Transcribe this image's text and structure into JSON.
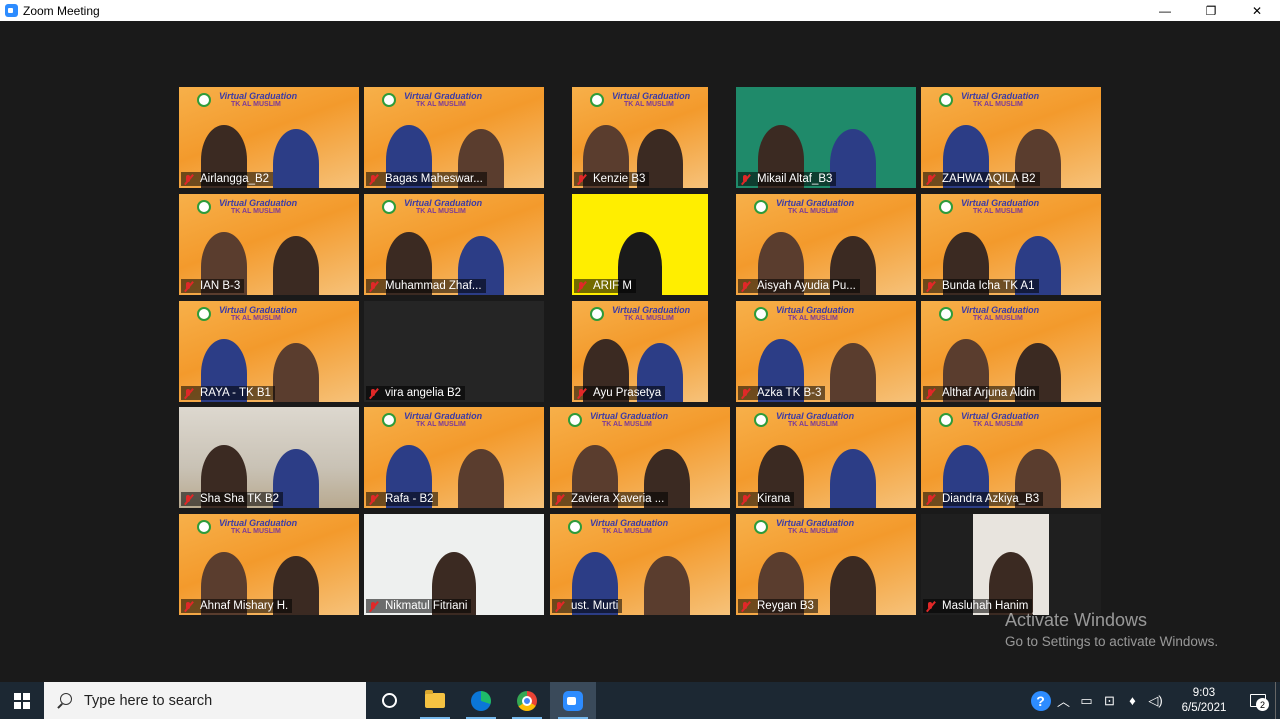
{
  "window": {
    "title": "Zoom Meeting",
    "minimize": "—",
    "restore": "❐",
    "close": "✕"
  },
  "banner": {
    "line1": "Virtual Graduation",
    "line2": "TK AL MUSLIM"
  },
  "participants": [
    {
      "name": "Airlangga_B2",
      "style": "orange",
      "muted": true
    },
    {
      "name": "Bagas Maheswar...",
      "style": "orange",
      "muted": true
    },
    {
      "name": "Kenzie B3",
      "style": "orange",
      "muted": true
    },
    {
      "name": "Mikail Altaf_B3",
      "style": "green",
      "muted": true
    },
    {
      "name": "ZAHWA AQILA B2",
      "style": "orange",
      "muted": true
    },
    {
      "name": "IAN B-3",
      "style": "orange",
      "muted": true
    },
    {
      "name": "Muhammad Zhaf...",
      "style": "orange",
      "muted": true
    },
    {
      "name": "ARIF M",
      "style": "yellow",
      "muted": true
    },
    {
      "name": "Aisyah Ayudia Pu...",
      "style": "orange",
      "muted": true
    },
    {
      "name": "Bunda Icha TK A1",
      "style": "orange",
      "muted": true
    },
    {
      "name": "RAYA - TK B1",
      "style": "orange",
      "muted": true
    },
    {
      "name": "vira angelia B2",
      "style": "dark",
      "muted": true
    },
    {
      "name": "Ayu Prasetya",
      "style": "orange",
      "muted": true
    },
    {
      "name": "Azka TK B-3",
      "style": "orange",
      "muted": true
    },
    {
      "name": "Althaf Arjuna Aldin",
      "style": "orange",
      "muted": true
    },
    {
      "name": "Sha Sha TK B2",
      "style": "room",
      "muted": true
    },
    {
      "name": "Rafa - B2",
      "style": "orange",
      "muted": true
    },
    {
      "name": "Zaviera Xaveria ...",
      "style": "orange",
      "muted": true
    },
    {
      "name": "Kirana",
      "style": "orange",
      "muted": true
    },
    {
      "name": "Diandra Azkiya_B3",
      "style": "orange",
      "muted": true
    },
    {
      "name": "Ahnaf Mishary H.",
      "style": "orange",
      "muted": true
    },
    {
      "name": "Nikmatul Fitriani",
      "style": "white",
      "muted": true
    },
    {
      "name": "ust. Murti",
      "style": "orange",
      "muted": true
    },
    {
      "name": "Reygan B3",
      "style": "orange",
      "muted": true
    },
    {
      "name": "Masluhah Hanim",
      "style": "portrait",
      "muted": true
    }
  ],
  "watermark": {
    "title": "Activate Windows",
    "subtitle": "Go to Settings to activate Windows."
  },
  "taskbar": {
    "search_placeholder": "Type here to search",
    "time": "9:03",
    "date": "6/5/2021",
    "notification_count": "2",
    "help": "?"
  }
}
